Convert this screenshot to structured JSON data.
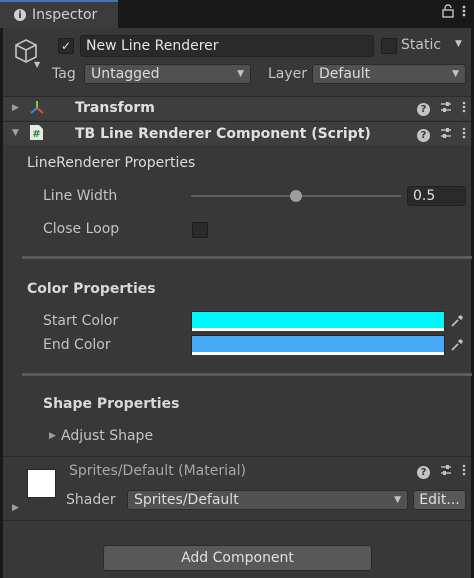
{
  "tab": {
    "title": "Inspector"
  },
  "header": {
    "active_checked": true,
    "object_name": "New Line Renderer",
    "static_label": "Static",
    "static_checked": false,
    "tag_label": "Tag",
    "tag_value": "Untagged",
    "layer_label": "Layer",
    "layer_value": "Default"
  },
  "components": {
    "transform": {
      "title": "Transform"
    },
    "script": {
      "title": "TB Line Renderer Component (Script)"
    }
  },
  "line_renderer": {
    "section_title": "LineRenderer Properties",
    "line_width_label": "Line Width",
    "line_width_value": "0.5",
    "line_width_fraction": 0.5,
    "close_loop_label": "Close Loop",
    "close_loop_checked": false
  },
  "color_props": {
    "section_title": "Color Properties",
    "start_color_label": "Start Color",
    "start_color": "#00f5ff",
    "end_color_label": "End Color",
    "end_color": "#47aaf5"
  },
  "shape_props": {
    "section_title": "Shape Properties",
    "adjust_shape_label": "Adjust Shape"
  },
  "material": {
    "title": "Sprites/Default (Material)",
    "shader_label": "Shader",
    "shader_value": "Sprites/Default",
    "edit_label": "Edit..."
  },
  "add_component_label": "Add Component"
}
